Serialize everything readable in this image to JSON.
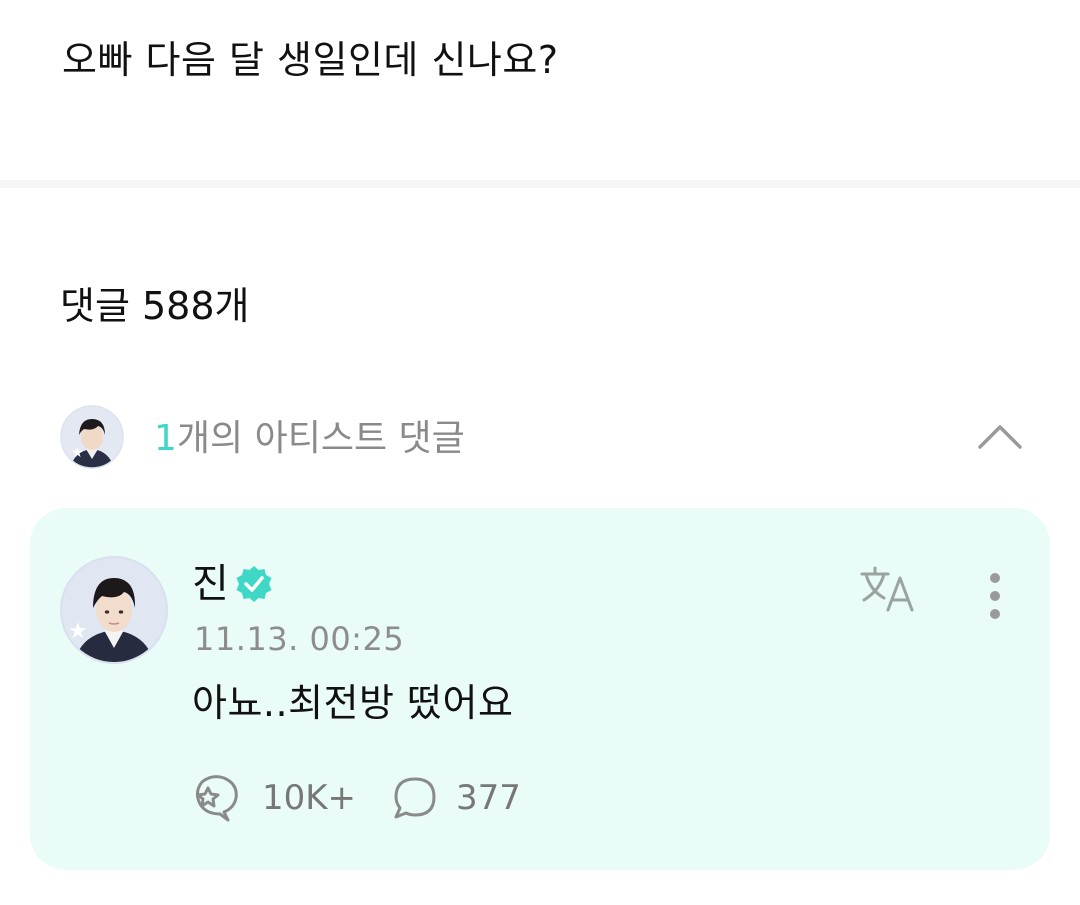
{
  "post": {
    "text": "오빠 다음 달 생일인데 신나요?"
  },
  "comments": {
    "count_label": "댓글 588개"
  },
  "artist_comments": {
    "count": "1",
    "label": "개의 아티스트 댓글",
    "collapse_icon": "chevron-up-icon"
  },
  "comment": {
    "author": "진",
    "verified_icon": "verified-badge-icon",
    "timestamp": "11.13. 00:25",
    "body": "아뇨..최전방 떴어요",
    "likes": "10K+",
    "replies": "377",
    "icons": {
      "translate": "translate-icon",
      "more": "more-vertical-icon",
      "like": "like-icon",
      "reply": "reply-bubble-icon"
    }
  },
  "colors": {
    "accent": "#3fd8c6",
    "card_background": "#e9fcf7",
    "muted_text": "#8a8a8a"
  }
}
